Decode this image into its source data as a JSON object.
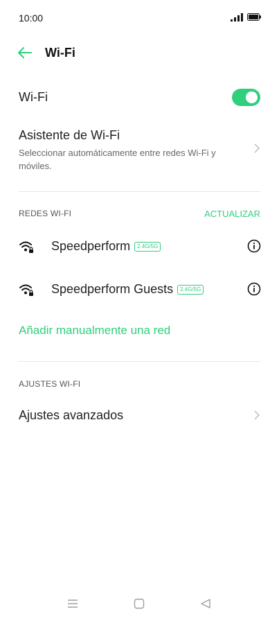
{
  "status_bar": {
    "time": "10:00"
  },
  "header": {
    "title": "Wi-Fi"
  },
  "wifi": {
    "label": "Wi-Fi",
    "enabled": true
  },
  "assistant": {
    "title": "Asistente de Wi-Fi",
    "description": "Seleccionar automáticamente entre redes Wi-Fi y móviles."
  },
  "networks_section": {
    "header": "REDES WI-FI",
    "refresh_label": "ACTUALIZAR",
    "items": [
      {
        "name": "Speedperform",
        "band": "2.4G/5G",
        "icon": "wifi-lock-icon"
      },
      {
        "name": "Speedperform Guests",
        "band": "2.4G/5G",
        "icon": "wifi-lock-icon"
      }
    ],
    "add_manual": "Añadir manualmente una red"
  },
  "settings_section": {
    "header": "AJUSTES WI-FI",
    "advanced": "Ajustes avanzados"
  },
  "colors": {
    "accent": "#2fcf7e",
    "text": "#1f1f1f",
    "secondary": "#666666"
  }
}
